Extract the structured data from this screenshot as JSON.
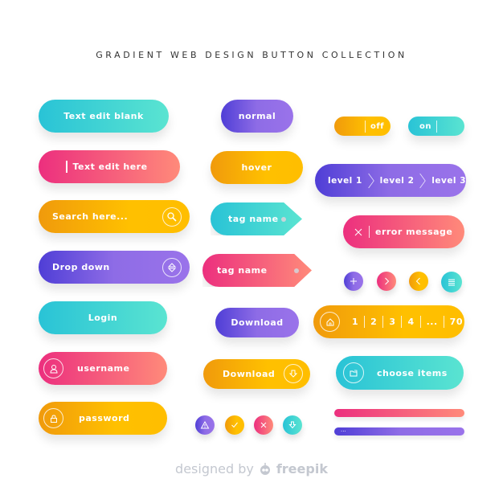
{
  "title": "GRADIENT WEB DESIGN BUTTON COLLECTION",
  "colors": {
    "teal": [
      "#29c3d6",
      "#5ae4d1"
    ],
    "pink": [
      "#ec2f7e",
      "#ff8a7a"
    ],
    "orange": [
      "#f09a0c",
      "#ffc000"
    ],
    "purple": [
      "#4f3ed6",
      "#9a73ea"
    ]
  },
  "left_column": {
    "text_edit_blank": "Text edit blank",
    "text_edit_here": "Text edit here",
    "search_placeholder": "Search here...",
    "drop_down": "Drop down",
    "login": "Login",
    "username": "username",
    "password": "password"
  },
  "middle_column": {
    "normal": "normal",
    "hover": "hover",
    "tag_name_1": "tag name",
    "tag_name_2": "tag name",
    "download_1": "Download",
    "download_2": "Download"
  },
  "right_column": {
    "toggle_off": "off",
    "toggle_on": "on",
    "breadcrumb": [
      "level 1",
      "level 2",
      "level 3"
    ],
    "error_message": "error message",
    "pagination": [
      "1",
      "2",
      "3",
      "4",
      "...",
      "70"
    ],
    "choose_items": "choose items",
    "progress_bar_label": "..."
  },
  "icons": {
    "round_row_right": [
      "plus-icon",
      "chevron-right-icon",
      "chevron-left-icon",
      "list-icon"
    ],
    "round_row_bottom": [
      "warning-icon",
      "check-icon",
      "close-icon",
      "download-arrow-icon"
    ]
  },
  "footer": {
    "prefix": "designed by",
    "brand": "freepik"
  }
}
